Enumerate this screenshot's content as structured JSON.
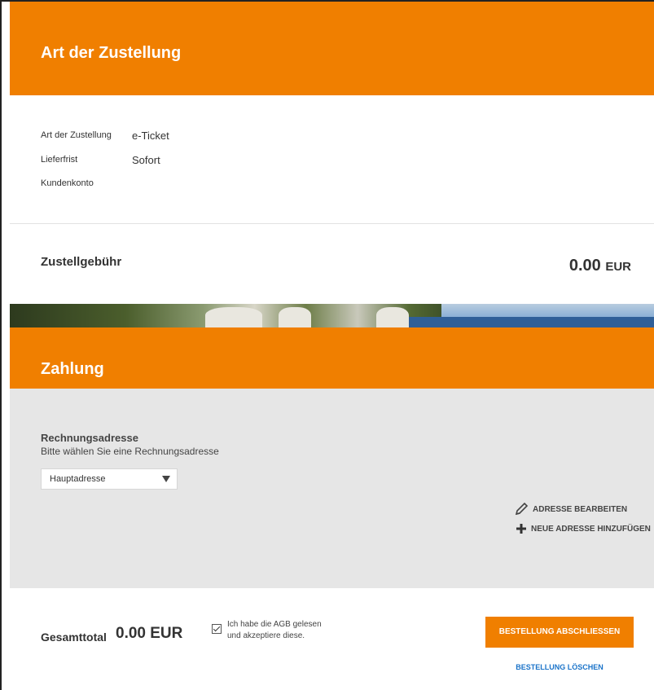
{
  "delivery_section": {
    "title": "Art der Zustellung",
    "rows": [
      {
        "label": "Art der Zustellung",
        "value": "e-Ticket"
      },
      {
        "label": "Lieferfrist",
        "value": "Sofort"
      },
      {
        "label": "Kundenkonto",
        "value": ""
      }
    ],
    "fee_label": "Zustellgebühr",
    "fee_amount": "0.00",
    "fee_currency": "EUR"
  },
  "payment_section": {
    "title": "Zahlung",
    "billing_title": "Rechnungsadresse",
    "billing_hint": "Bitte wählen Sie eine Rechnungsadresse",
    "address_select": "Hauptadresse",
    "edit_address": "ADRESSE BEARBEITEN",
    "add_address": "NEUE ADRESSE HINZUFÜGEN"
  },
  "footer": {
    "total_label": "Gesamttotal",
    "total_amount": "0.00 EUR",
    "agb_text_line1": "Ich habe die AGB gelesen",
    "agb_text_line2": "und akzeptiere diese.",
    "order_button": "BESTELLUNG ABSCHLIESSEN",
    "delete_order": "BESTELLUNG LÖSCHEN"
  },
  "colors": {
    "accent": "#f07f00",
    "link": "#1a73c9",
    "panel_gray": "#e6e6e6"
  }
}
